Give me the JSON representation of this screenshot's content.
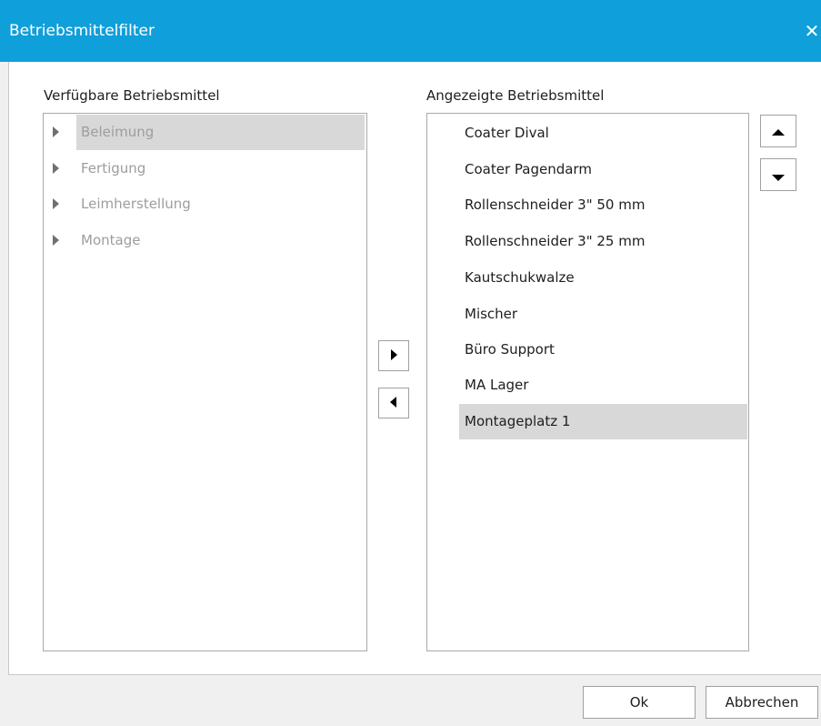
{
  "window": {
    "title": "Betriebsmittelfilter"
  },
  "icons": {
    "close": "close-icon",
    "move_right": "triangle-right-icon",
    "move_left": "triangle-left-icon",
    "move_up": "triangle-up-icon",
    "move_down": "triangle-down-icon",
    "expand": "triangle-right-icon"
  },
  "available": {
    "label": "Verfügbare Betriebsmittel",
    "items": [
      {
        "label": "Beleimung",
        "selected": true
      },
      {
        "label": "Fertigung",
        "selected": false
      },
      {
        "label": "Leimherstellung",
        "selected": false
      },
      {
        "label": "Montage",
        "selected": false
      }
    ]
  },
  "displayed": {
    "label": "Angezeigte Betriebsmittel",
    "items": [
      {
        "label": "Coater Dival",
        "selected": false
      },
      {
        "label": "Coater Pagendarm",
        "selected": false
      },
      {
        "label": "Rollenschneider 3\" 50 mm",
        "selected": false
      },
      {
        "label": "Rollenschneider 3\" 25 mm",
        "selected": false
      },
      {
        "label": "Kautschukwalze",
        "selected": false
      },
      {
        "label": "Mischer",
        "selected": false
      },
      {
        "label": "Büro Support",
        "selected": false
      },
      {
        "label": "MA Lager",
        "selected": false
      },
      {
        "label": "Montageplatz 1",
        "selected": true
      }
    ]
  },
  "footer": {
    "ok_label": "Ok",
    "cancel_label": "Abbrechen"
  },
  "colors": {
    "titlebar": "#0f9fda",
    "selection": "#d8d8d8",
    "disabled_text": "#9d9d9d"
  }
}
